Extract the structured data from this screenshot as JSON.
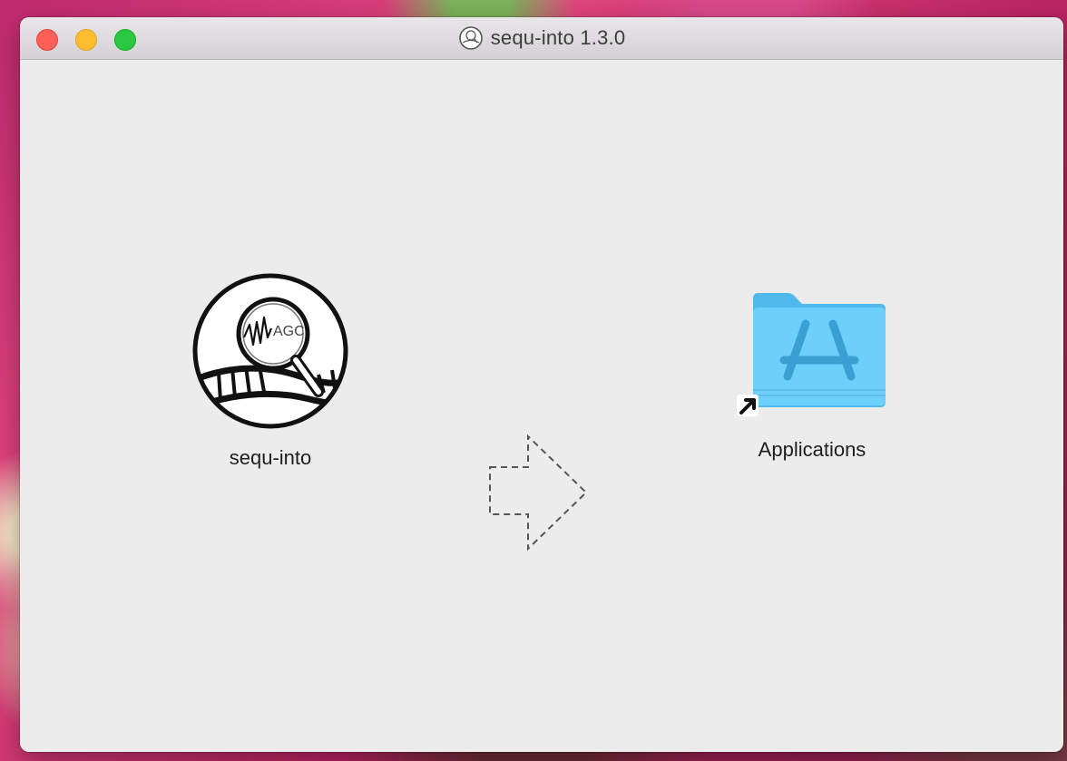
{
  "window": {
    "title": "sequ-into 1.3.0",
    "traffic_lights": {
      "close_color": "#fe5f57",
      "minimize_color": "#febc2e",
      "zoom_color": "#28c840"
    }
  },
  "installer": {
    "app": {
      "label": "sequ-into",
      "icon": "sequ-into-app-icon",
      "icon_text": "AGC"
    },
    "arrow": {
      "icon": "drag-arrow-icon"
    },
    "applications": {
      "label": "Applications",
      "icon": "applications-folder-alias-icon",
      "folder_color": "#5ac8fa"
    }
  }
}
